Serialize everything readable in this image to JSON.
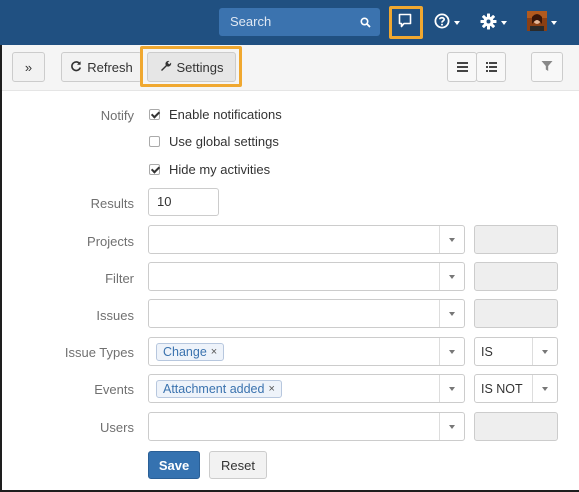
{
  "header": {
    "search_placeholder": "Search",
    "icons": [
      "search-icon",
      "feedback-icon",
      "help-icon",
      "gear-icon",
      "avatar"
    ]
  },
  "toolbar": {
    "expand_label": "»",
    "refresh_label": "Refresh",
    "settings_label": "Settings",
    "icons": [
      "list-view-icon",
      "detail-view-icon",
      "filter-icon"
    ]
  },
  "form": {
    "notify_label": "Notify",
    "enable_notifications": "Enable notifications",
    "use_global_settings": "Use global settings",
    "hide_my_activities": "Hide my activities",
    "checks": {
      "enable_notifications": true,
      "use_global_settings": false,
      "hide_my_activities": true
    },
    "results_label": "Results",
    "results_value": "10",
    "projects_label": "Projects",
    "filter_label": "Filter",
    "issues_label": "Issues",
    "issue_types_label": "Issue Types",
    "issue_types_tag": "Change",
    "issue_types_op": "IS",
    "events_label": "Events",
    "events_tag": "Attachment added",
    "events_op": "IS NOT",
    "users_label": "Users",
    "tag_remove": "×"
  },
  "actions": {
    "save_label": "Save",
    "reset_label": "Reset"
  },
  "colors": {
    "navbar": "#205081",
    "highlight": "#f0a830",
    "primary": "#3572b0"
  }
}
